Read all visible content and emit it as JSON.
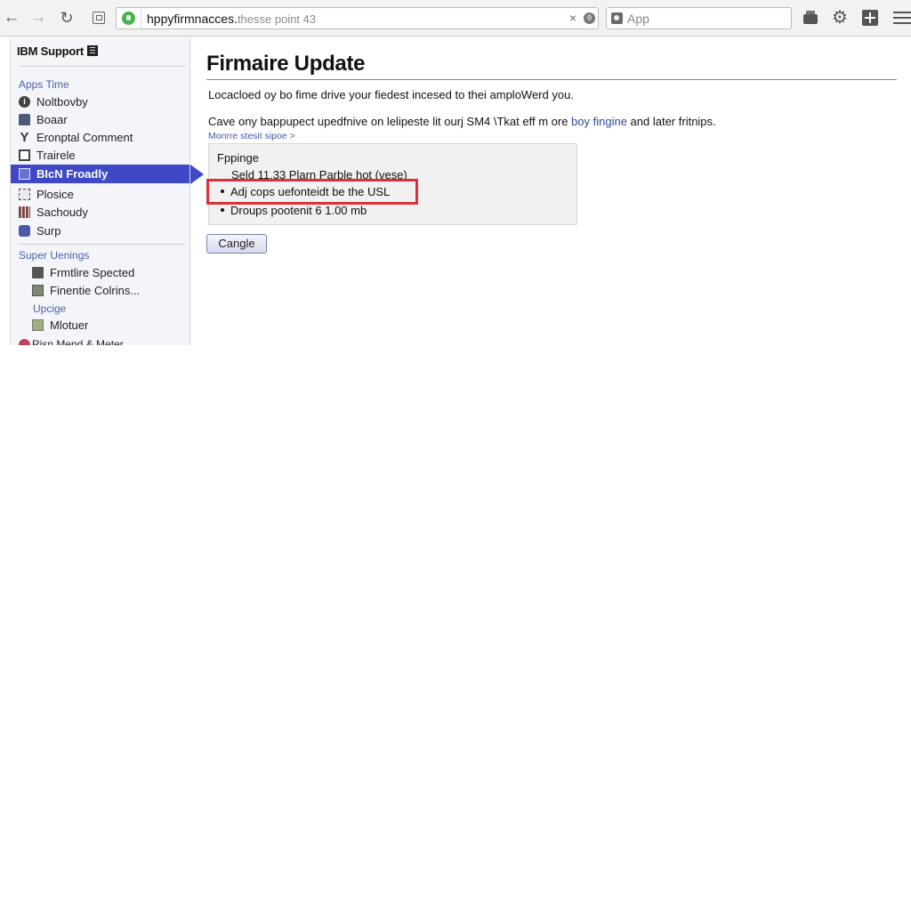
{
  "browser": {
    "url_host": "hppyfirmnacces.",
    "url_path": "thesse point 43",
    "url_clear_glyph": "×",
    "url_info_glyph": "θ",
    "search_placeholder": "App",
    "icons": {
      "back": "←",
      "forward": "→",
      "reload": "↻",
      "gear": "⚙"
    }
  },
  "sidebar": {
    "brand": "IBM Support",
    "sections": [
      {
        "title": "Apps Time",
        "items": [
          {
            "label": "Noltbovby",
            "icon": "info-icon"
          },
          {
            "label": "Boaar",
            "icon": "board-icon"
          },
          {
            "label": "Eronptal Comment",
            "icon": "antenna-icon"
          },
          {
            "label": "Trairele",
            "icon": "frame-icon"
          },
          {
            "label": "BIcN Froadly",
            "icon": "document-icon",
            "active": true
          },
          {
            "label": "Plosice",
            "icon": "plosice-icon"
          },
          {
            "label": "Sachoudy",
            "icon": "calendar-icon"
          },
          {
            "label": "Surp",
            "icon": "phone-icon"
          }
        ]
      },
      {
        "title": "Super Uenings",
        "items": [
          {
            "label": "Frmtlire Spected",
            "icon": "firmware-icon"
          },
          {
            "label": "Finentie Colrins...",
            "icon": "panel-icon"
          }
        ]
      },
      {
        "title": "Upcige",
        "items": [
          {
            "label": "Mlotuer",
            "icon": "motor-icon"
          },
          {
            "label": "Risn Mend & Meter",
            "icon": "risk-icon"
          }
        ]
      }
    ]
  },
  "main": {
    "title": "Firmaire Update",
    "paragraph1": "Locacloed oy bo fime drive your fiedest incesed to thei amploWerd you.",
    "paragraph2_prefix": "Cave ony bappupect upedfnive on lelipeste lit ourj SM4 \\Tkat eff m ore ",
    "paragraph2_link": "boy fingine",
    "paragraph2_suffix": " and later fritnips.",
    "more_link": "Monrre stesit sipoe >",
    "details": {
      "heading": "Fppinge",
      "line": "Seld 11.33 Plarn Parble hot (vese)",
      "bullets": [
        "Adj cops uefonteidt be the USL",
        "Droups pootenit 6 1.00 mb"
      ],
      "highlighted_bullet_index": 0
    },
    "cancel_label": "Cangle"
  },
  "colors": {
    "accent": "#3f49c8",
    "highlight": "#d8323a",
    "link": "#2a4a9a",
    "secure": "#4caf50"
  }
}
